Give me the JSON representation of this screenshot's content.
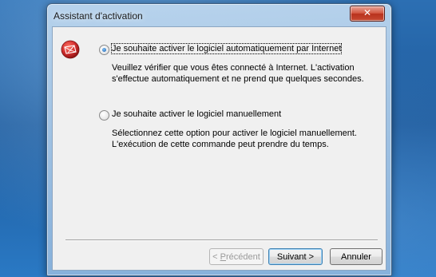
{
  "window": {
    "title": "Assistant d'activation"
  },
  "options": [
    {
      "label": "Je souhaite activer le logiciel automatiquement par Internet",
      "selected": true,
      "description": "Veuillez vérifier que vous êtes connecté à Internet. L'activation s'effectue automatiquement et ne prend que quelques secondes."
    },
    {
      "label": "Je souhaite activer le logiciel manuellement",
      "selected": false,
      "description": "Sélectionnez cette option pour activer le logiciel manuellement. L'exécution de cette commande peut prendre du temps."
    }
  ],
  "buttons": {
    "previous": {
      "prefix": "< ",
      "mnemonic": "P",
      "rest": "récédent",
      "enabled": false
    },
    "next": {
      "label": "Suivant >"
    },
    "cancel": {
      "label": "Annuler"
    }
  },
  "icons": {
    "close": "close-icon",
    "logo": "activation-logo-icon"
  },
  "colors": {
    "logo_red": "#d32f2f",
    "close_red": "#c74a32"
  }
}
